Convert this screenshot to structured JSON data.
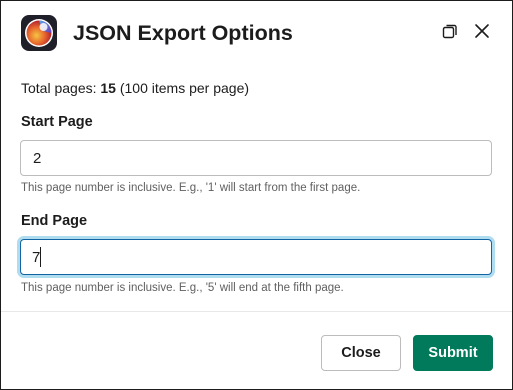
{
  "dialog": {
    "title": "JSON Export Options",
    "app_icon": "app-logo-icon",
    "header_buttons": {
      "restore_icon": "restore-window-icon",
      "close_icon": "close-icon"
    }
  },
  "summary": {
    "prefix": "Total pages: ",
    "count": "15",
    "suffix": " (100 items per page)"
  },
  "start_page": {
    "label": "Start Page",
    "value": "2",
    "hint": "This page number is inclusive. E.g., '1' will start from the first page."
  },
  "end_page": {
    "label": "End Page",
    "value": "7",
    "hint": "This page number is inclusive. E.g., '5' will end at the fifth page.",
    "focused": true
  },
  "footer": {
    "close_label": "Close",
    "submit_label": "Submit"
  },
  "colors": {
    "submit_bg": "#007a5a",
    "focus_ring": "#1264a3",
    "text": "#1d1c1d",
    "hint_text": "#616061"
  }
}
